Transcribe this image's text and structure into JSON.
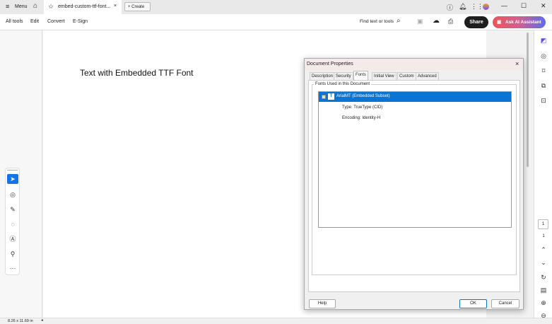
{
  "tabbar": {
    "menu_label": "Menu",
    "tab_title": "embed-custom-ttf-font...",
    "create_label": "Create"
  },
  "toolbar": {
    "items": [
      "All tools",
      "Edit",
      "Convert",
      "E-Sign"
    ],
    "find_label": "Find text or tools",
    "share_label": "Share",
    "ai_label": "Ask AI Assistant"
  },
  "document": {
    "text": "Text with Embedded TTF Font"
  },
  "status": {
    "page_size": "8.26 x 11.69 in"
  },
  "navigation": {
    "page_input": "1",
    "page_count": "1"
  },
  "dialog": {
    "title": "Document Properties",
    "tabs": [
      "Description",
      "Security",
      "Fonts",
      "Initial View",
      "Custom",
      "Advanced"
    ],
    "active_tab": "Fonts",
    "group_label": "Fonts Used in this Document",
    "font_name": "ArialMT (Embedded Subset)",
    "font_type": "Type: TrueType (CID)",
    "font_encoding": "Encoding: Identity-H",
    "help_label": "Help",
    "ok_label": "OK",
    "cancel_label": "Cancel"
  },
  "colors": {
    "selection": "#0a74d4",
    "share_bg": "#1e1e1e",
    "ai_gradient_start": "#f0535a",
    "ai_gradient_end": "#5a6cf0",
    "tool_active": "#1473e6"
  }
}
